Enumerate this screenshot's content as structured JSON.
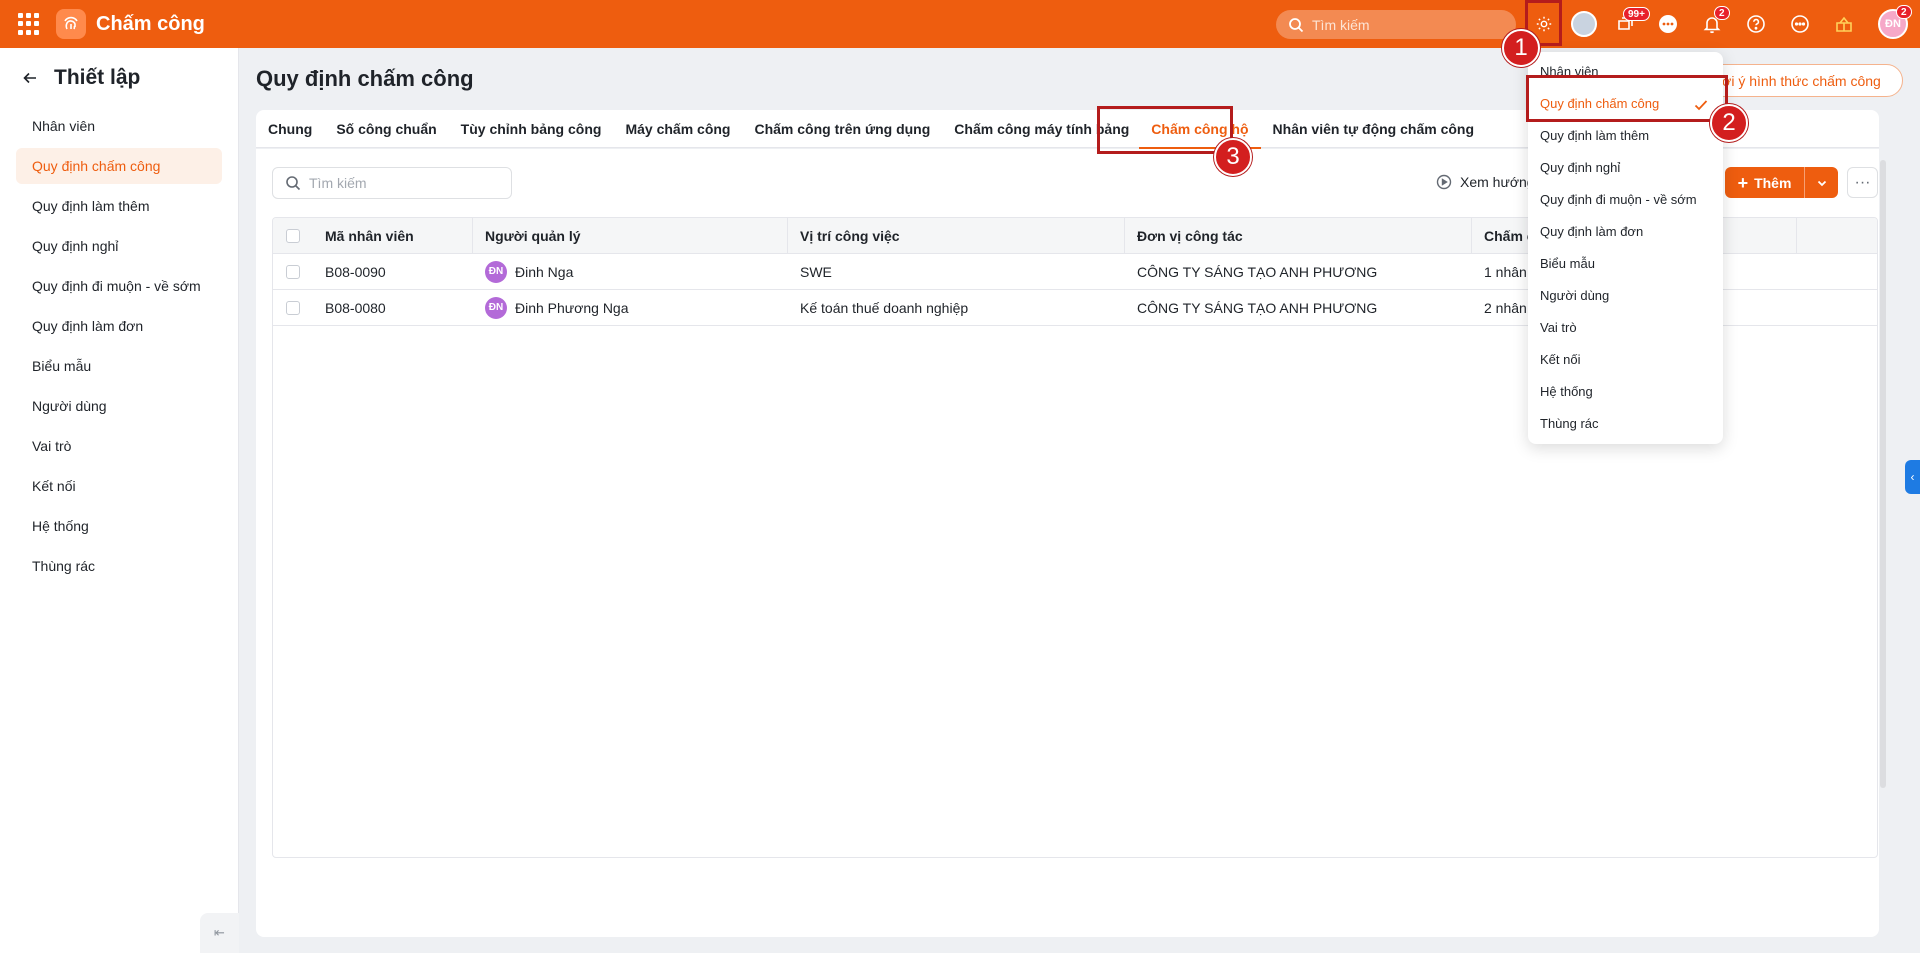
{
  "app": {
    "title": "Chấm công",
    "search_placeholder": "Tìm kiếm"
  },
  "topbar": {
    "badges": {
      "tasks": "99+",
      "notifications": "2",
      "avatar": "2"
    },
    "avatar_initials": "ĐN",
    "icons": [
      "apps-grid-icon",
      "fingerprint-icon",
      "search-icon",
      "gear-icon",
      "avatar-icon",
      "tasks-icon",
      "chat-icon",
      "bell-icon",
      "help-icon",
      "more-icon",
      "gift-icon"
    ]
  },
  "sidebar": {
    "title": "Thiết lập",
    "items": [
      {
        "label": "Nhân viên"
      },
      {
        "label": "Quy định chấm công"
      },
      {
        "label": "Quy định làm thêm"
      },
      {
        "label": "Quy định nghỉ"
      },
      {
        "label": "Quy định đi muộn - về sớm"
      },
      {
        "label": "Quy định làm đơn"
      },
      {
        "label": "Biểu mẫu"
      },
      {
        "label": "Người dùng"
      },
      {
        "label": "Vai trò"
      },
      {
        "label": "Kết nối"
      },
      {
        "label": "Hệ thống"
      },
      {
        "label": "Thùng rác"
      }
    ],
    "active_index": 1
  },
  "main": {
    "title": "Quy định chấm công",
    "hint_button": "ợi ý hình thức chấm công",
    "tabs": [
      {
        "label": "Chung"
      },
      {
        "label": "Số công chuẩn"
      },
      {
        "label": "Tùy chỉnh bảng công"
      },
      {
        "label": "Máy chấm công"
      },
      {
        "label": "Chấm công trên ứng dụng"
      },
      {
        "label": "Chấm công máy tính bảng"
      },
      {
        "label": "Chấm công hộ"
      },
      {
        "label": "Nhân viên tự động chấm công"
      }
    ],
    "active_tab": 6,
    "search_placeholder": "Tìm kiếm",
    "guide_label": "Xem hướng",
    "add_label": "Thêm",
    "table": {
      "columns": [
        "Mã nhân viên",
        "Người quản lý",
        "Vị trí công việc",
        "Đơn vị công tác",
        "Chấm c"
      ],
      "rows": [
        {
          "code": "B08-0090",
          "initials": "ĐN",
          "manager": "Đinh Nga",
          "position": "SWE",
          "unit": "CÔNG TY SÁNG TẠO ANH PHƯƠNG",
          "count": "1 nhân"
        },
        {
          "code": "B08-0080",
          "initials": "ĐN",
          "manager": "Đinh Phương Nga",
          "position": "Kế toán thuế doanh nghiệp",
          "unit": "CÔNG TY SÁNG TẠO ANH PHƯƠNG",
          "count": "2 nhân"
        }
      ]
    }
  },
  "settings_menu": {
    "items": [
      {
        "label": "Nhân viên"
      },
      {
        "label": "Quy định chấm công"
      },
      {
        "label": "Quy định làm thêm"
      },
      {
        "label": "Quy định nghỉ"
      },
      {
        "label": "Quy định đi muộn - về sớm"
      },
      {
        "label": "Quy định làm đơn"
      },
      {
        "label": "Biểu mẫu"
      },
      {
        "label": "Người dùng"
      },
      {
        "label": "Vai trò"
      },
      {
        "label": "Kết nối"
      },
      {
        "label": "Hệ thống"
      },
      {
        "label": "Thùng rác"
      }
    ],
    "active_index": 1
  },
  "annotations": {
    "step1": "1",
    "step2": "2",
    "step3": "3"
  },
  "colors": {
    "brand": "#ee5d0f",
    "annotation": "#d31f1f",
    "active_bg": "#fdf0e7"
  }
}
